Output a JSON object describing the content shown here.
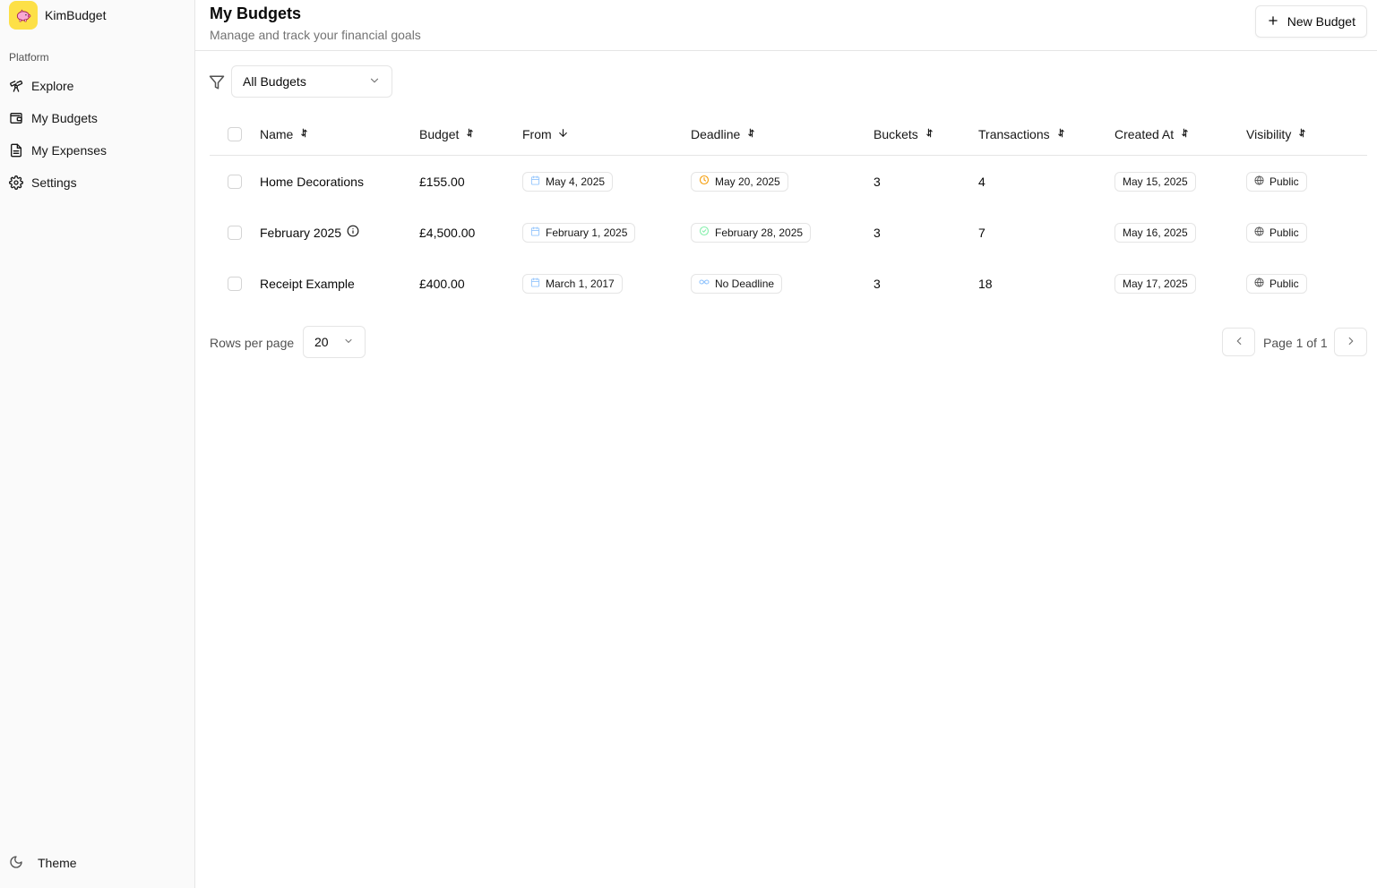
{
  "app": {
    "name": "KimBudget"
  },
  "sidebar": {
    "group_label": "Platform",
    "items": [
      {
        "label": "Explore",
        "icon": "telescope-icon"
      },
      {
        "label": "My Budgets",
        "icon": "wallet-icon"
      },
      {
        "label": "My Expenses",
        "icon": "receipt-icon"
      },
      {
        "label": "Settings",
        "icon": "gear-icon"
      }
    ],
    "theme_label": "Theme"
  },
  "header": {
    "title": "My Budgets",
    "subtitle": "Manage and track your financial goals",
    "new_button_label": "New Budget"
  },
  "filter": {
    "selected": "All Budgets"
  },
  "table": {
    "columns": [
      "Name",
      "Budget",
      "From",
      "Deadline",
      "Buckets",
      "Transactions",
      "Created At",
      "Visibility"
    ],
    "rows": [
      {
        "name": "Home Decorations",
        "budget": "£155.00",
        "from": "May 4, 2025",
        "deadline": "May 20, 2025",
        "deadline_status": "pending",
        "buckets": "3",
        "transactions": "4",
        "created_at": "May 15, 2025",
        "visibility": "Public"
      },
      {
        "name": "February 2025",
        "has_info": true,
        "budget": "£4,500.00",
        "from": "February 1, 2025",
        "deadline": "February 28, 2025",
        "deadline_status": "completed",
        "buckets": "3",
        "transactions": "7",
        "created_at": "May 16, 2025",
        "visibility": "Public"
      },
      {
        "name": "Receipt Example",
        "budget": "£400.00",
        "from": "March 1, 2017",
        "deadline": "No Deadline",
        "deadline_status": "none",
        "buckets": "3",
        "transactions": "18",
        "created_at": "May 17, 2025",
        "visibility": "Public"
      }
    ]
  },
  "pagination": {
    "rows_per_page_label": "Rows per page",
    "rows_per_page": "20",
    "page_info": "Page 1 of 1"
  },
  "colors": {
    "brand_logo_bg": "#fde047",
    "calendar_icon": "#93c5fd",
    "clock_icon": "#f59e0b",
    "check_icon": "#86efac",
    "infinity_icon": "#93c5fd"
  }
}
